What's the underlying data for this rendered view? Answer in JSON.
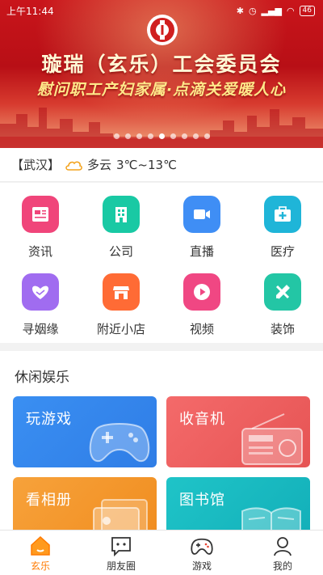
{
  "status_bar": {
    "time": "上午11:44",
    "battery": "46"
  },
  "banner": {
    "title": "璇瑞（玄乐）工会委员会",
    "subtitle": "慰问职工产妇家属·点滴关爱暖人心",
    "dot_count": 9,
    "active_dot": 4
  },
  "weather": {
    "city": "【武汉】",
    "condition": "多云",
    "temperature": "3℃~13℃"
  },
  "grid": {
    "items": [
      {
        "label": "资讯",
        "color": "#f0457a",
        "icon": "news-icon"
      },
      {
        "label": "公司",
        "color": "#19c9a4",
        "icon": "building-icon"
      },
      {
        "label": "直播",
        "color": "#3f8ef5",
        "icon": "video-camera-icon"
      },
      {
        "label": "医疗",
        "color": "#1fb5d8",
        "icon": "medical-kit-icon"
      },
      {
        "label": "寻姻缘",
        "color": "#a06cf0",
        "icon": "heart-hands-icon"
      },
      {
        "label": "附近小店",
        "color": "#ff6b35",
        "icon": "shop-icon"
      },
      {
        "label": "视频",
        "color": "#f04783",
        "icon": "play-icon"
      },
      {
        "label": "装饰",
        "color": "#23c6a5",
        "icon": "ruler-pencil-icon"
      }
    ]
  },
  "leisure": {
    "title": "休闲娱乐",
    "cards": [
      {
        "label": "玩游戏",
        "color_top": "#3a8ff2",
        "color_bottom": "#2f7de6",
        "icon": "gamepad-icon"
      },
      {
        "label": "收音机",
        "color_top": "#f46a6a",
        "color_bottom": "#e65454",
        "icon": "radio-icon"
      },
      {
        "label": "看相册",
        "color_top": "#f7a23b",
        "color_bottom": "#f08c1e",
        "icon": "photo-album-icon"
      },
      {
        "label": "图书馆",
        "color_top": "#1fc4c8",
        "color_bottom": "#12aeb8",
        "icon": "book-icon"
      }
    ]
  },
  "tabbar": {
    "active": 0,
    "accent": "#ff7a00",
    "items": [
      {
        "label": "玄乐",
        "icon": "home-icon"
      },
      {
        "label": "朋友圈",
        "icon": "chat-icon"
      },
      {
        "label": "游戏",
        "icon": "gamepad-icon"
      },
      {
        "label": "我的",
        "icon": "user-icon"
      }
    ]
  }
}
